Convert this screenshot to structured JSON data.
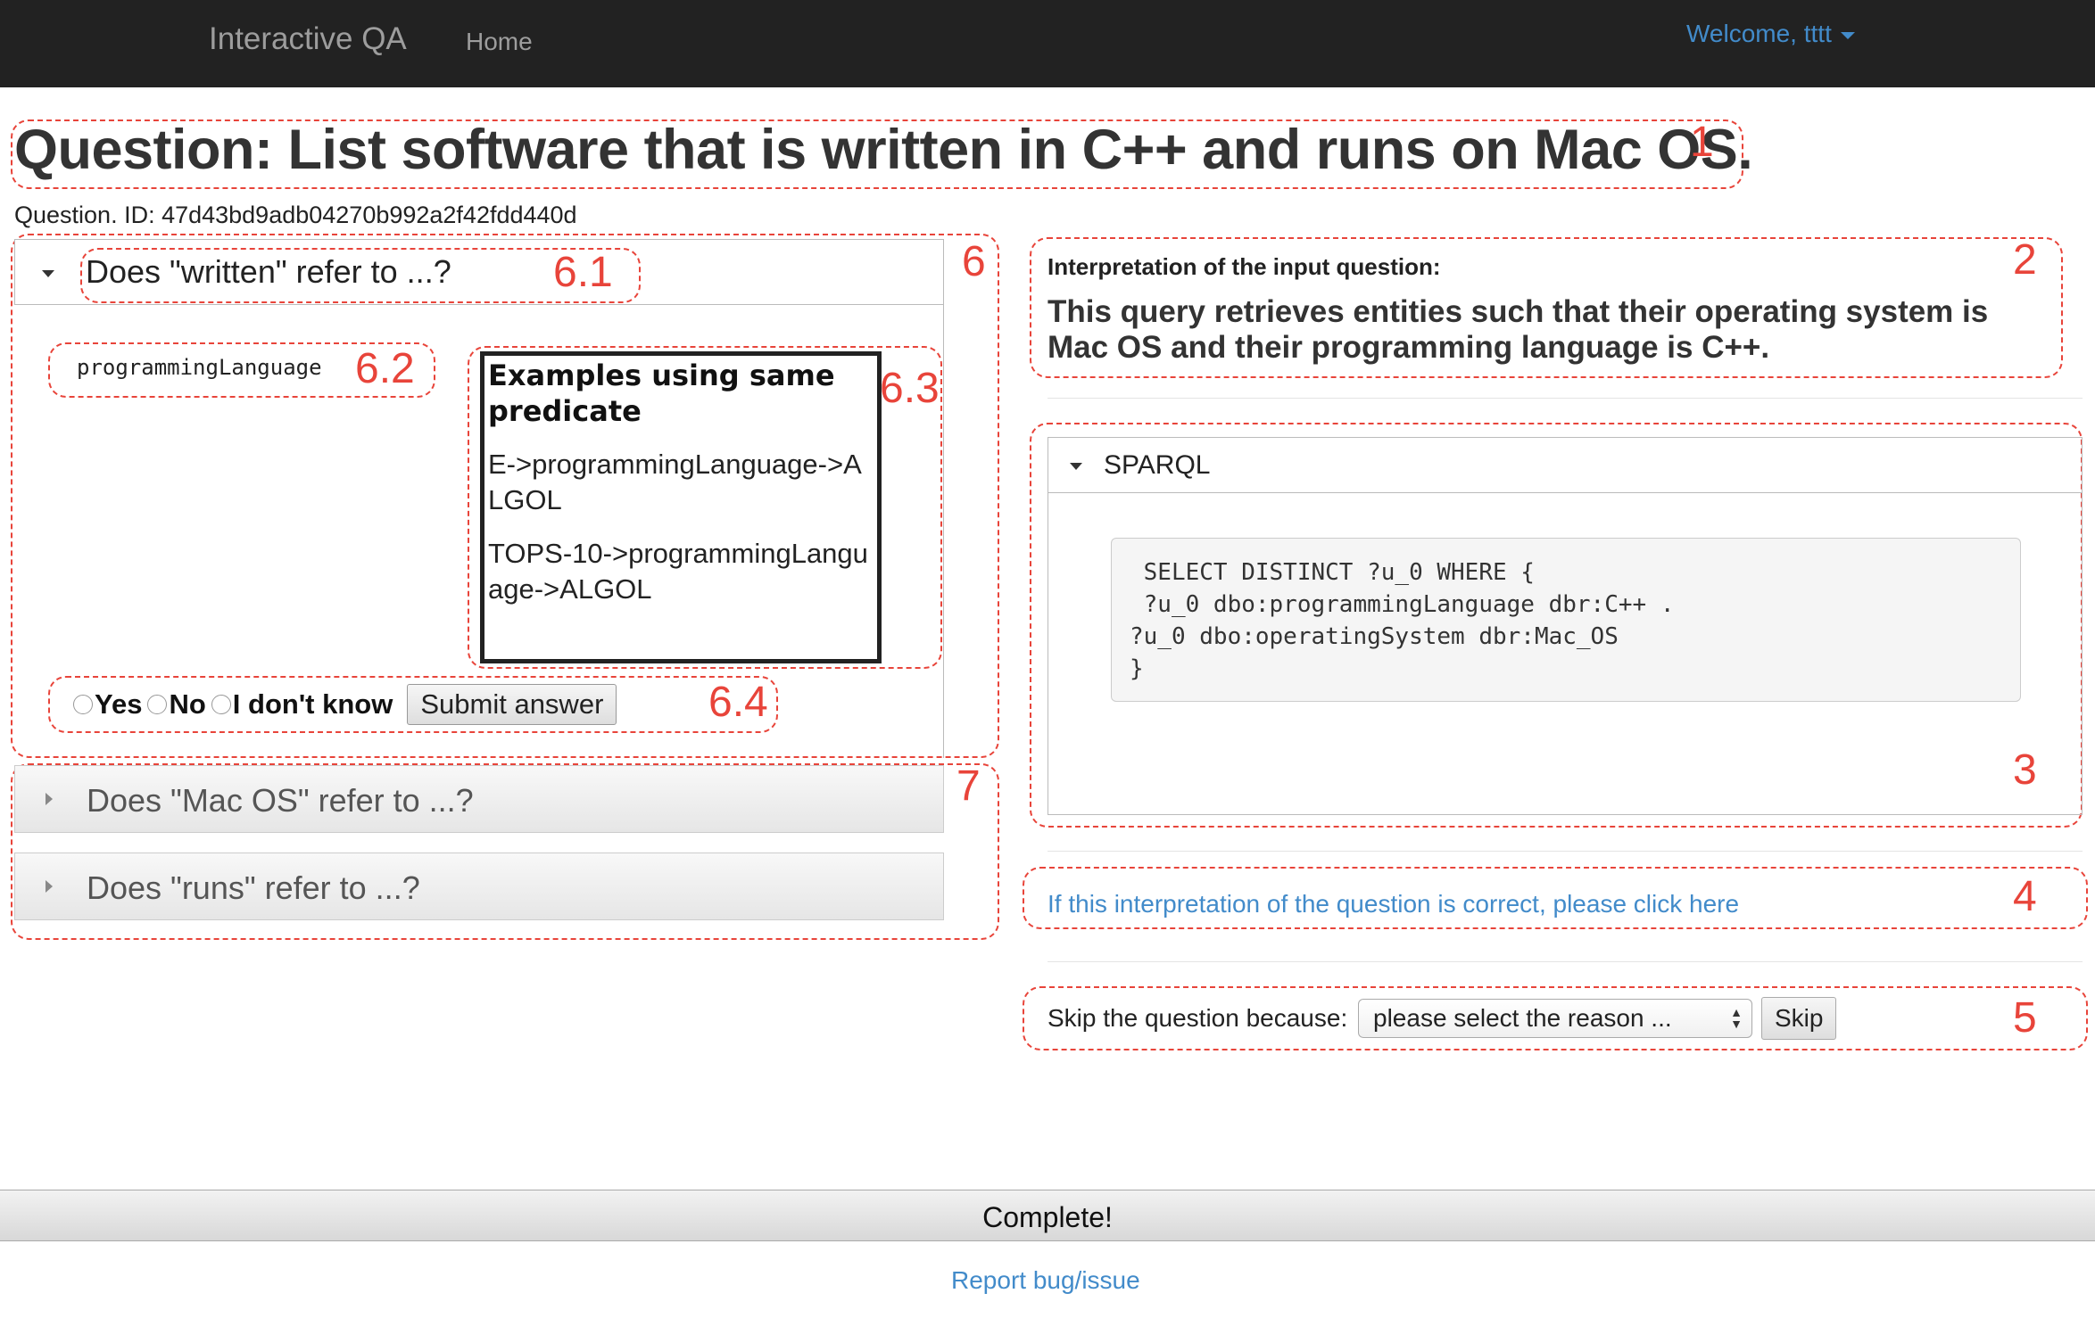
{
  "navbar": {
    "brand": "Interactive QA",
    "home": "Home",
    "welcome": "Welcome, tttt"
  },
  "question": {
    "title": "Question: List software that is written in C++ and runs on Mac OS.",
    "id": "Question. ID: 47d43bd9adb04270b992a2f42fdd440d"
  },
  "markers": {
    "m1": "1",
    "m2": "2",
    "m3": "3",
    "m4": "4",
    "m5": "5",
    "m6": "6",
    "m61": "6.1",
    "m62": "6.2",
    "m63": "6.3",
    "m64": "6.4",
    "m7": "7"
  },
  "ambiguity": {
    "open_question": "Does \"written\" refer to ...?",
    "predicate": "programmingLanguage",
    "examples_title": "Examples using same predicate",
    "examples": [
      "E->programmingLanguage->ALGOL",
      "TOPS-10->programmingLanguage->ALGOL"
    ],
    "options": [
      "Yes",
      "No",
      "I don't know"
    ],
    "submit": "Submit answer",
    "collapsed": [
      "Does \"Mac OS\" refer to ...?",
      "Does \"runs\" refer to ...?"
    ]
  },
  "interpretation": {
    "title": "Interpretation of the input question:",
    "text": "This query retrieves entities such that their operating system is Mac OS and their programming language is C++."
  },
  "sparql": {
    "label": "SPARQL",
    "query": " SELECT DISTINCT ?u_0 WHERE {\n ?u_0 dbo:programmingLanguage dbr:C++ .\n?u_0 dbo:operatingSystem dbr:Mac_OS\n}"
  },
  "correct_link": "If this interpretation of the question is correct, please click here",
  "skip": {
    "label": "Skip the question because:",
    "select_value": "please select the reason ...",
    "button": "Skip"
  },
  "complete": "Complete!",
  "report": "Report bug/issue",
  "colors": {
    "navbar": "#222222",
    "link": "#428bca",
    "annotation": "#e8443a"
  }
}
